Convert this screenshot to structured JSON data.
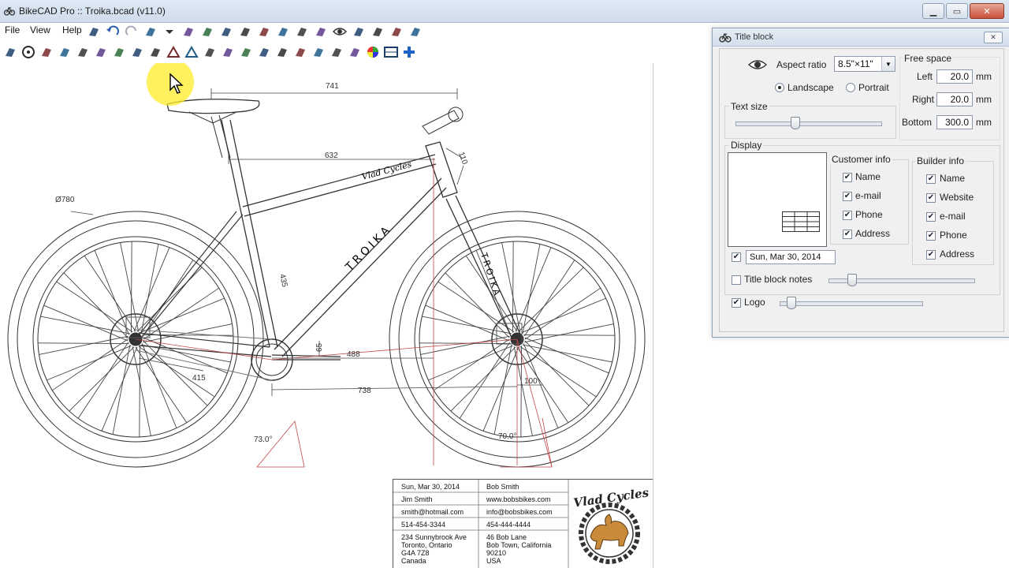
{
  "window": {
    "title": "BikeCAD Pro :: Troika.bcad (v11.0)"
  },
  "menu": {
    "file": "File",
    "view": "View",
    "help": "Help"
  },
  "toolbar1_icons": [
    "template-icon",
    "undo-icon",
    "redo-icon",
    "frame-view-icon",
    "dropdown-icon",
    "bottle-cage-icon",
    "tube-icon",
    "fork-icon",
    "dimension-icon",
    "gear-icon",
    "chainline-icon",
    "decal-icon",
    "paint-icon",
    "eye-icon",
    "tubing-icon",
    "check-icon",
    "print-icon",
    "export-icon"
  ],
  "toolbar2_icons": [
    "pen-icon",
    "wheel-icon",
    "fork-blade-icon",
    "stem-icon",
    "handlebar-icon",
    "headset-icon",
    "seatpost-icon",
    "saddle-icon",
    "pedal-icon",
    "frame-triangle-icon",
    "rear-triangle-icon",
    "bottle-icon",
    "dropout-icon",
    "crank-icon",
    "derailleur-icon",
    "brake-icon",
    "fender-icon",
    "rack-icon",
    "light-icon",
    "kickstand-icon",
    "color-wheel-icon",
    "title-block-icon",
    "add-icon"
  ],
  "drawing": {
    "dims": {
      "d741": "741",
      "d632": "632",
      "d110": "110",
      "d780": "Ø780",
      "d435": "435",
      "d488": "488",
      "d738": "738",
      "d415": "415",
      "d100": "100",
      "d65": "65",
      "a73": "73.0°",
      "a70": "70.0°"
    },
    "logo_text": "Vlad Cycles",
    "downtube_text": "TROIKA",
    "fork_text": "TROIKA"
  },
  "title_block": {
    "date": "Sun, Mar 30, 2014",
    "customer_name": "Jim Smith",
    "customer_email": "smith@hotmail.com",
    "customer_phone": "514-454-3344",
    "customer_address": [
      "234 Sunnybrook Ave",
      "Toronto, Ontario",
      "G4A 7Z8",
      "Canada"
    ],
    "builder_name": "Bob Smith",
    "builder_website": "www.bobsbikes.com",
    "builder_email": "info@bobsbikes.com",
    "builder_phone": "454-444-4444",
    "builder_address": [
      "46 Bob Lane",
      "Bob Town, California",
      "90210",
      "USA"
    ],
    "logo_text": "Vlad Cycles"
  },
  "dialog": {
    "title": "Title block",
    "aspect_ratio_label": "Aspect ratio",
    "aspect_ratio_value": "8.5\"×11\"",
    "landscape_label": "Landscape",
    "portrait_label": "Portrait",
    "orientation": "Landscape",
    "free_space_label": "Free space",
    "left_label": "Left",
    "left_value": "20.0",
    "right_label": "Right",
    "right_value": "20.0",
    "bottom_label": "Bottom",
    "bottom_value": "300.0",
    "unit": "mm",
    "text_size_label": "Text size",
    "text_size_level": 0.4,
    "display_label": "Display",
    "customer_info_label": "Customer info",
    "customer_fields": [
      "Name",
      "e-mail",
      "Phone",
      "Address"
    ],
    "builder_info_label": "Builder info",
    "builder_fields": [
      "Name",
      "Website",
      "e-mail",
      "Phone",
      "Address"
    ],
    "date_checked": true,
    "date_value": "Sun, Mar 30, 2014",
    "notes_label": "Title block notes",
    "notes_checked": false,
    "notes_level": 0.14,
    "logo_label": "Logo",
    "logo_checked": true,
    "logo_level": 0.05
  },
  "colors": {
    "accent_red": "#c2474a",
    "titlebar": "#d6e2ef",
    "dialog_bg": "#f0f0f0"
  }
}
